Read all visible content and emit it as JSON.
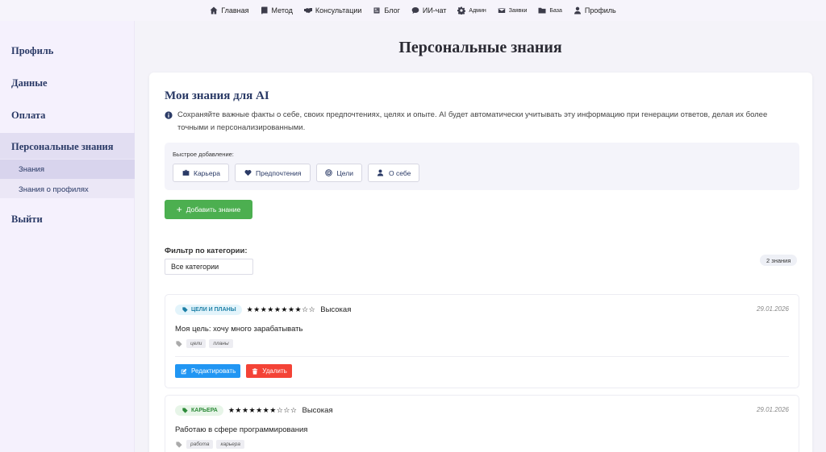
{
  "topnav": {
    "items": [
      {
        "label": "Главная",
        "icon": "home-icon"
      },
      {
        "label": "Метод",
        "icon": "book-icon"
      },
      {
        "label": "Консультации",
        "icon": "handshake-icon"
      },
      {
        "label": "Блог",
        "icon": "newspaper-icon"
      },
      {
        "label": "ИИ-чат",
        "icon": "chat-icon"
      },
      {
        "label": "Админ",
        "icon": "gear-icon"
      },
      {
        "label": "Заявки",
        "icon": "envelope-icon"
      },
      {
        "label": "База",
        "icon": "folder-icon"
      },
      {
        "label": "Профиль",
        "icon": "user-icon"
      }
    ]
  },
  "sidebar": {
    "profile": "Профиль",
    "data": "Данные",
    "payment": "Оплата",
    "personal_knowledge": "Персональные знания",
    "sub_knowledge": "Знания",
    "sub_profiles": "Знания о профилях",
    "logout": "Выйти"
  },
  "page": {
    "title": "Персональные знания"
  },
  "card": {
    "title": "Мои знания для AI",
    "info": "Сохраняйте важные факты о себе, своих предпочтениях, целях и опыте. AI будет автоматически учитывать эту информацию при генерации ответов, делая их более точными и персонализированными.",
    "quick_label": "Быстрое добавление:",
    "quick_buttons": [
      {
        "label": "Карьера",
        "icon": "briefcase-icon"
      },
      {
        "label": "Предпочтения",
        "icon": "heart-icon"
      },
      {
        "label": "Цели",
        "icon": "target-icon"
      },
      {
        "label": "О себе",
        "icon": "user-icon"
      }
    ],
    "add_button": "Добавить знание",
    "filter_label": "Фильтр по категории:",
    "filter_value": "Все категории",
    "count_badge": "2 знания"
  },
  "knowledge": [
    {
      "category": "ЦЕЛИ И ПЛАНЫ",
      "stars": "★★★★★★★★☆☆",
      "priority": "Высокая",
      "date": "29.01.2026",
      "text": "Моя цель: хочу много зарабатывать",
      "tags": [
        "цели",
        "планы"
      ],
      "edit_label": "Редактировать",
      "delete_label": "Удалить"
    },
    {
      "category": "КАРЬЕРА",
      "stars": "★★★★★★★☆☆☆",
      "priority": "Высокая",
      "date": "29.01.2026",
      "text": "Работаю в сфере программирования",
      "tags": [
        "работа",
        "карьера"
      ]
    }
  ],
  "colors": {
    "accent_navy": "#2a3a66",
    "add_green": "#4caf50",
    "edit_blue": "#2196f3",
    "delete_red": "#f44336",
    "goals_badge_bg": "#e3f4fb",
    "goals_badge_fg": "#1c7fa6",
    "career_badge_bg": "#e7f5e8",
    "career_badge_fg": "#2e8b3a"
  }
}
